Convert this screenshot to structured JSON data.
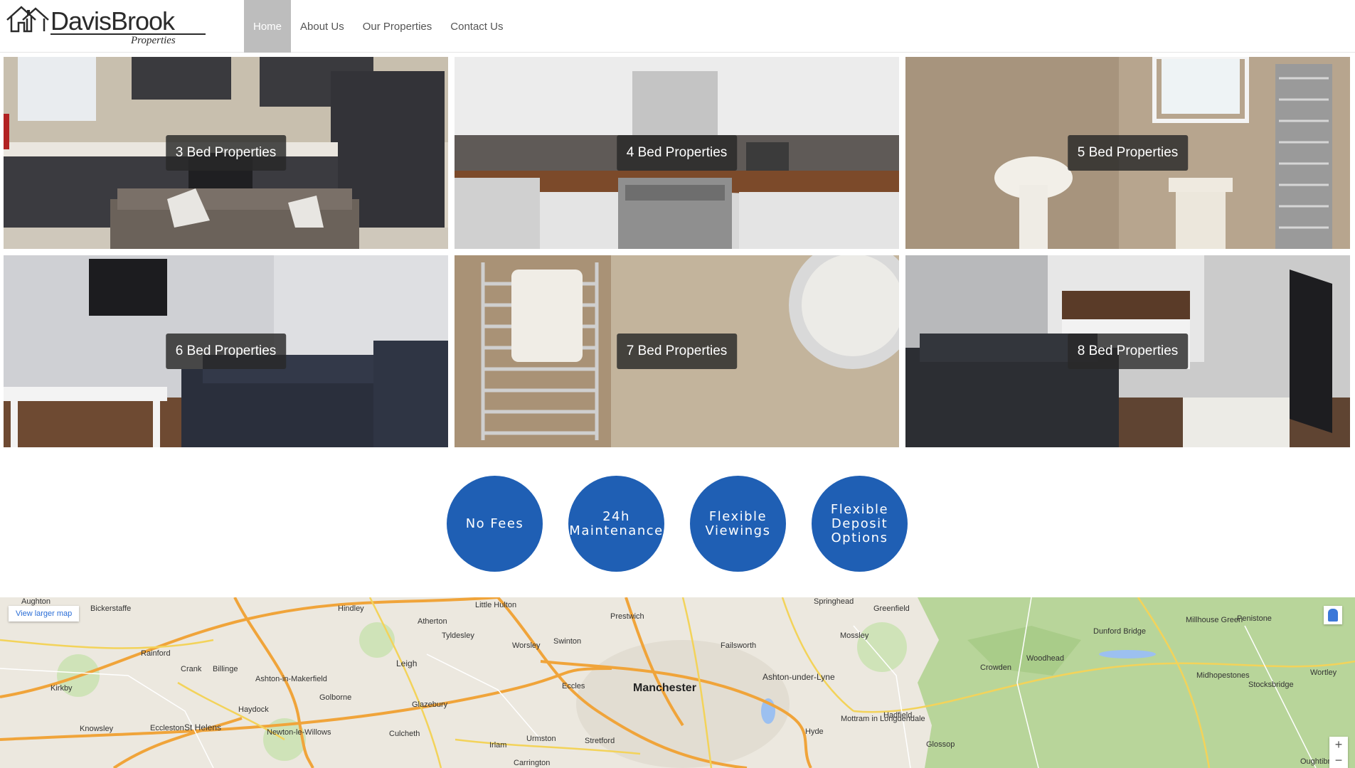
{
  "header": {
    "logo_name": "DavisBrook",
    "logo_sub": "Properties",
    "nav": [
      "Home",
      "About Us",
      "Our Properties",
      "Contact Us"
    ],
    "active_nav": "Home"
  },
  "properties": [
    {
      "label": "3 Bed Properties"
    },
    {
      "label": "4 Bed Properties"
    },
    {
      "label": "5 Bed Properties"
    },
    {
      "label": "6 Bed Properties"
    },
    {
      "label": "7 Bed Properties"
    },
    {
      "label": "8 Bed Properties"
    }
  ],
  "features": [
    {
      "label": "No Fees"
    },
    {
      "label": "24h Maintenance"
    },
    {
      "label": "Flexible Viewings"
    },
    {
      "label": "Flexible Deposit Options"
    }
  ],
  "map": {
    "link": "View larger map",
    "zoom_in": "+",
    "zoom_out": "−",
    "places": [
      "Manchester",
      "Leigh",
      "St Helens",
      "Atherton",
      "Tyldesley",
      "Worsley",
      "Swinton",
      "Prestwich",
      "Failsworth",
      "Ashton-under-Lyne",
      "Mossley",
      "Greenfield",
      "Eccles",
      "Stretford",
      "Urmston",
      "Irlam",
      "Hyde",
      "Glossop",
      "Hadfield",
      "Rainford",
      "Kirkby",
      "Knowsley",
      "Crank",
      "Billinge",
      "Haydock",
      "Golborne",
      "Glazebury",
      "Culcheth",
      "Newton-le-Willows",
      "Eccleston",
      "Ashton-in-Makerfield",
      "Bickerstaffe",
      "Hindley",
      "Little Hulton",
      "Carrington",
      "Crowden",
      "Woodhead",
      "Dunford Bridge",
      "Millhouse Green",
      "Penistone",
      "Midhopestones",
      "Stocksbridge",
      "Wortley",
      "Mottram in Longdendale",
      "Oughtibr",
      "Aughton",
      "Springhead"
    ]
  }
}
